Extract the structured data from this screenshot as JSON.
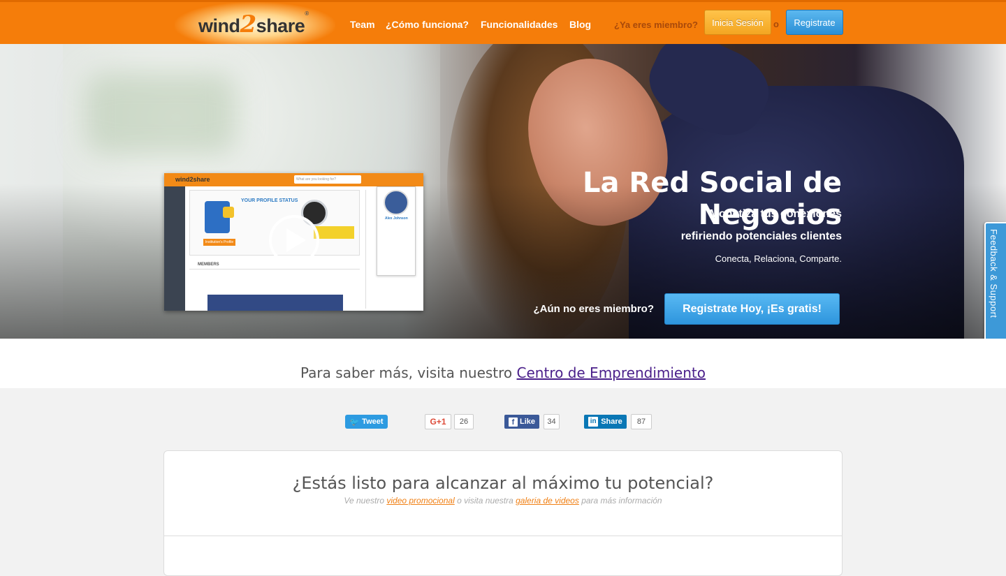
{
  "header": {
    "logo": {
      "part1": "wind",
      "part2": "2",
      "part3": "share",
      "mark": "®"
    },
    "nav": [
      "Team",
      "¿Cómo funciona?",
      "Funcionalidades",
      "Blog"
    ],
    "member_question": "¿Ya eres miembro?",
    "login_label": "Inicia Sesión",
    "or_label": "o",
    "register_label": "Registrate"
  },
  "hero": {
    "title": "La Red Social de Negocios",
    "line1": "Monetiza tus conexiones",
    "line2": "refiriendo potenciales clientes",
    "line3": "Conecta, Relaciona, Comparte.",
    "not_member": "¿Aún no eres miembro?",
    "cta_label": "Registrate Hoy, ¡Es gratis!",
    "video": {
      "logo": "wind2share",
      "search_placeholder": "What are you looking for?",
      "profile_title": "YOUR PROFILE STATUS",
      "profile_button": "Institution's Profile",
      "members_label": "MEMBERS",
      "popup_name": "Alex Johnson"
    }
  },
  "feedback_tab": "Feedback & Support",
  "learn_more": {
    "text": "Para saber más, visita nuestro ",
    "link": "Centro de Emprendimiento"
  },
  "social": {
    "tweet": "Tweet",
    "gplus": "G+1",
    "gplus_count": "26",
    "facebook": "Like",
    "facebook_icon": "f",
    "facebook_count": "34",
    "linkedin": "Share",
    "linkedin_icon": "in",
    "linkedin_count": "87"
  },
  "panel": {
    "title": "¿Estás listo para alcanzar al máximo tu potencial?",
    "info_pre": "Ve nuestro ",
    "video_link": "video promocional",
    "info_mid": " o visita nuestra ",
    "gallery_link": "galeria de videos",
    "info_post": " para más información"
  },
  "colors": {
    "brand_orange": "#f57d0a",
    "accent_blue": "#2e95dd",
    "login_yellow": "#f3a622"
  }
}
